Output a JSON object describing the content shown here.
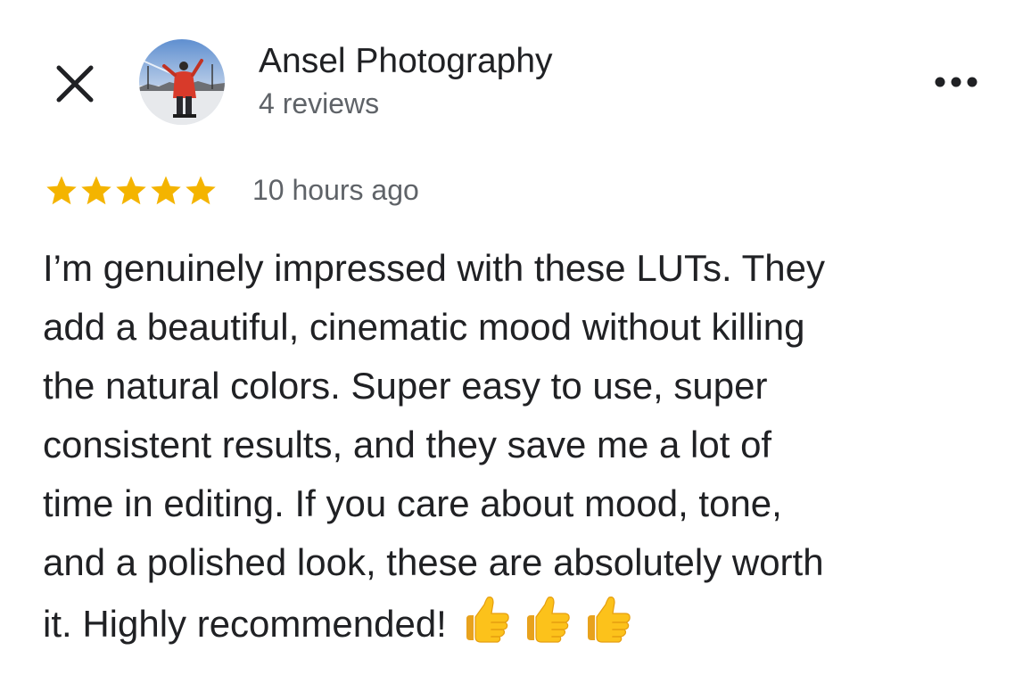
{
  "reviewer": {
    "name": "Ansel Photography",
    "review_count": "4 reviews"
  },
  "review": {
    "rating": 5,
    "rating_max": 5,
    "time": "10 hours ago",
    "lines": [
      "I’m genuinely impressed with these LUTs. They",
      "add a beautiful, cinematic mood without killing",
      "the natural colors. Super easy to use, super",
      "consistent results, and they save me a lot of",
      "time in editing. If you care about mood, tone,",
      "and a polished look, these are absolutely worth",
      "it. Highly recommended!"
    ],
    "emojis": [
      "thumbs-up-icon",
      "thumbs-up-icon",
      "thumbs-up-icon"
    ]
  },
  "icons": {
    "close": "close-icon",
    "more": "more-options-icon",
    "star": "star-icon"
  },
  "colors": {
    "star": "#f4b400",
    "primary_text": "#202124",
    "secondary_text": "#5f6368"
  }
}
